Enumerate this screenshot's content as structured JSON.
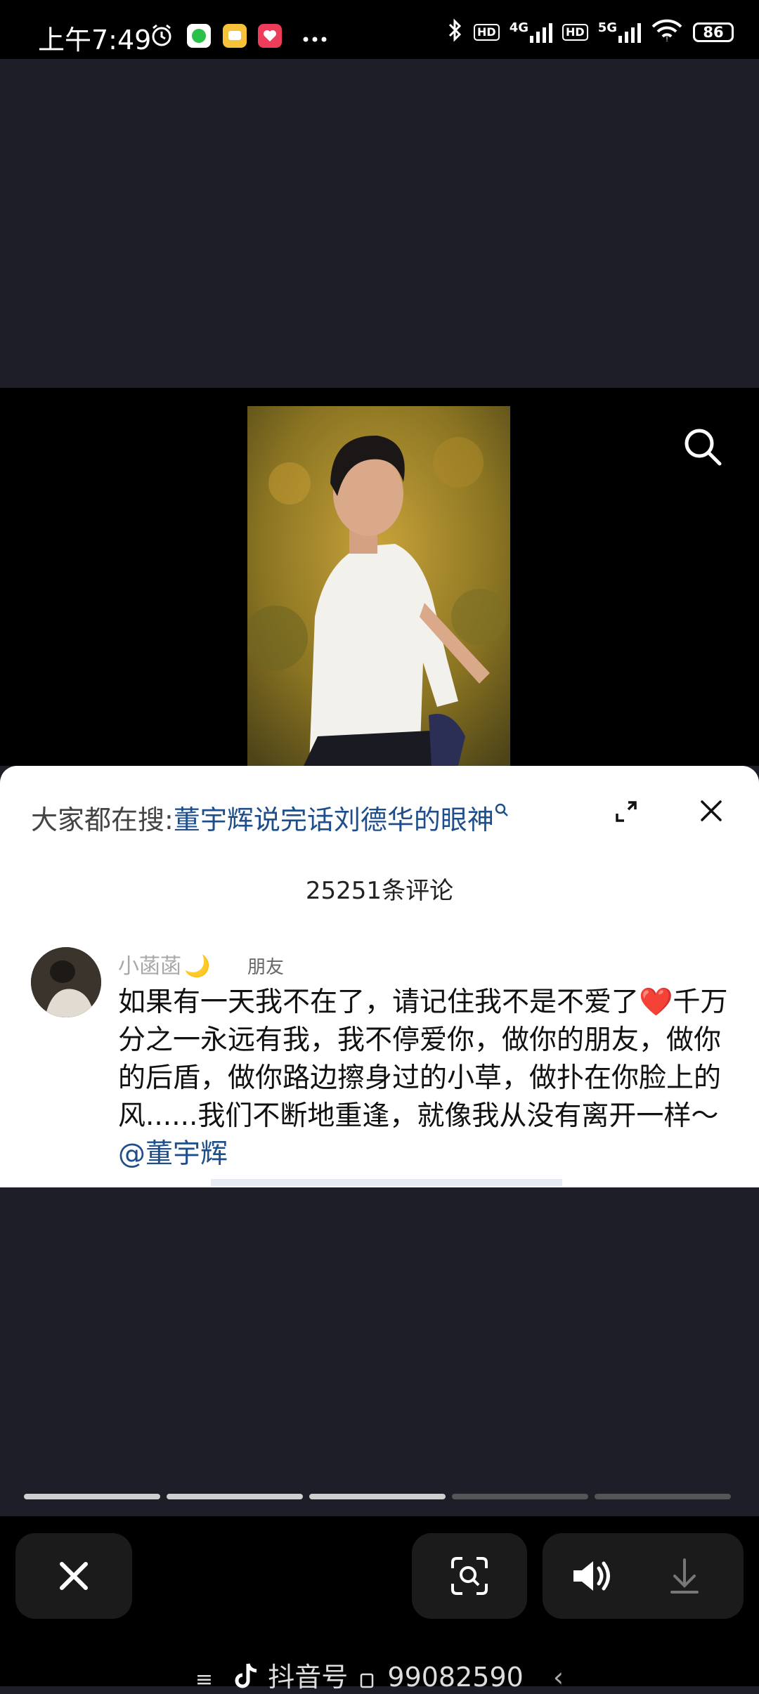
{
  "status_bar": {
    "time": "上午7:49",
    "bluetooth_icon": "bluetooth-icon",
    "hd1": "HD",
    "net1": "4G",
    "hd2": "HD",
    "net2": "5G",
    "battery": "86"
  },
  "video": {
    "search_icon": "search-icon"
  },
  "comment_sheet": {
    "hot_search_prefix": "大家都在搜:",
    "hot_search_query": "董宇辉说完话刘德华的眼神",
    "comment_count": "25251条评论",
    "comment": {
      "user": "小菡菡",
      "emoji": "🌙",
      "tag": "朋友",
      "text": "如果有一天我不在了，请记住我不是不爱了❤️千万分之一永远有我，我不停爱你，做你的朋友，做你的后盾，做你路边擦身过的小草，做扑在你脸上的风......我们不断地重逢，就像我从没有离开一样～",
      "mention": "@董宇辉"
    }
  },
  "progress": {
    "segments_total": 5,
    "segments_completed": 3
  },
  "bottom_bar": {
    "watermark_prefix": "≡",
    "watermark_label": "抖音号",
    "watermark_id": "99082590",
    "back_glyph": "‹"
  },
  "colors": {
    "background": "#1d1e27",
    "link": "#1f4f8a",
    "heart": "#e0262d"
  }
}
